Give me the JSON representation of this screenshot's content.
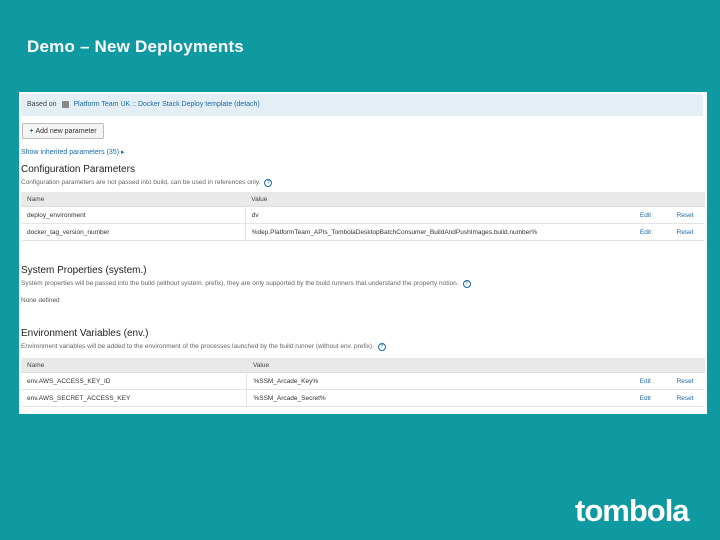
{
  "slide": {
    "title": "Demo – New Deployments"
  },
  "based_on": {
    "label": "Based on",
    "project": "Platform Team UK",
    "separator": "::",
    "template": "Docker Stack Deploy template",
    "detach": "(detach)"
  },
  "add_parameter": {
    "label": "Add new parameter"
  },
  "show_inherited": {
    "label": "Show inherited parameters (35) ▸"
  },
  "config_params": {
    "title": "Configuration Parameters",
    "description": "Configuration parameters are not passed into build, can be used in references only.",
    "columns": [
      "Name",
      "Value"
    ],
    "rows": [
      {
        "name": "deploy_environment",
        "value": "dv",
        "edit": "Edit",
        "reset": "Reset"
      },
      {
        "name": "docker_tag_version_number",
        "value": "%dep.PlatformTeam_APIs_TombolaDesktopBatchConsumer_BuildAndPushImages.build.number%",
        "edit": "Edit",
        "reset": "Reset"
      }
    ]
  },
  "system_props": {
    "title": "System Properties (system.)",
    "description": "System properties will be passed into the build (without system. prefix), they are only supported by the build runners that understand the property notion.",
    "none": "None defined"
  },
  "env_vars": {
    "title": "Environment Variables (env.)",
    "description": "Environment variables will be added to the environment of the processes launched by the build runner (without env. prefix).",
    "columns": [
      "Name",
      "Value"
    ],
    "rows": [
      {
        "name": "env.AWS_ACCESS_KEY_ID",
        "value": "%SSM_Arcade_Key%",
        "edit": "Edit",
        "reset": "Reset"
      },
      {
        "name": "env.AWS_SECRET_ACCESS_KEY",
        "value": "%SSM_Arcade_Secret%",
        "edit": "Edit",
        "reset": "Reset"
      }
    ]
  },
  "logo": {
    "text": "tombola"
  }
}
